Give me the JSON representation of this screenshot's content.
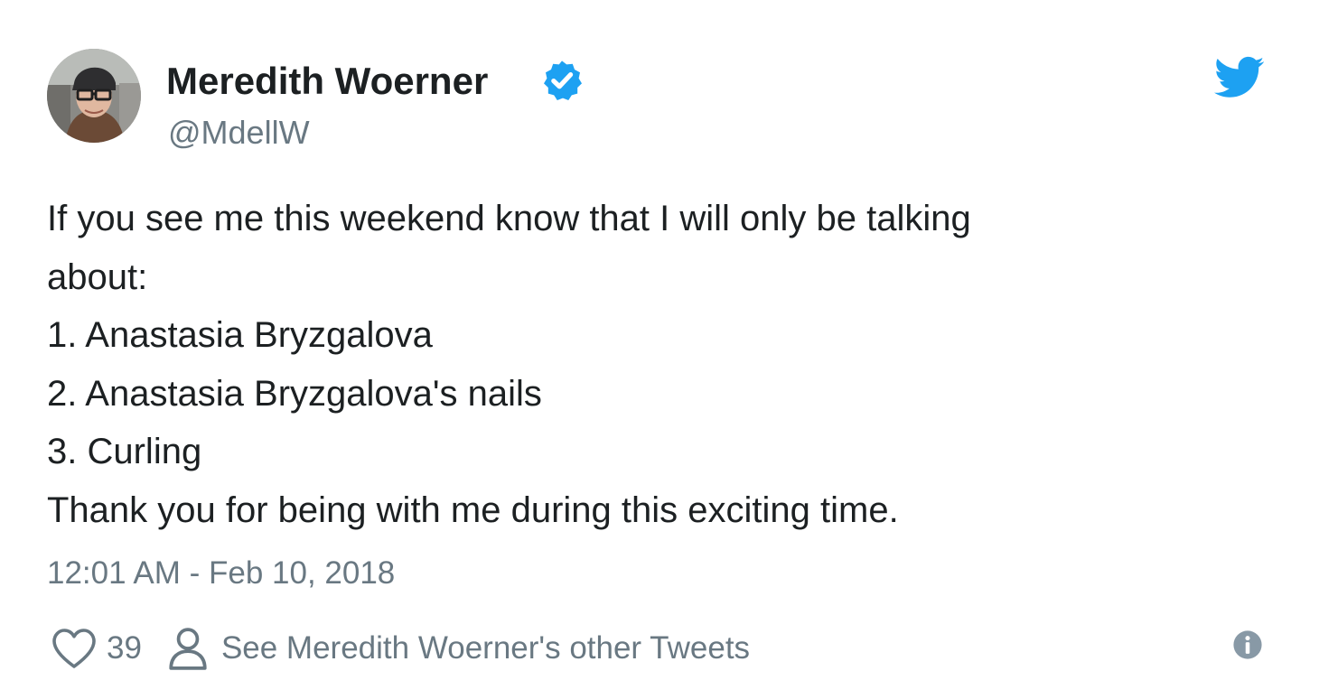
{
  "author": {
    "display_name": "Meredith Woerner",
    "handle": "@MdellW",
    "verified": true
  },
  "tweet": {
    "lines": [
      "If you see me this weekend know that I will only be talking",
      "about:",
      "1. Anastasia Bryzgalova",
      "2. Anastasia Bryzgalova's nails",
      "3. Curling",
      "Thank you for being with me during this exciting time."
    ],
    "timestamp": "12:01 AM - Feb 10, 2018"
  },
  "actions": {
    "like_count": "39",
    "other_tweets_label": "See Meredith Woerner's other Tweets"
  },
  "icons": {
    "brand": "twitter-bird-icon",
    "verified": "verified-badge-icon",
    "like": "heart-icon",
    "profile": "person-icon",
    "info": "info-icon"
  },
  "colors": {
    "twitter_blue": "#1da1f2",
    "text": "#1c2022",
    "muted": "#697882"
  }
}
